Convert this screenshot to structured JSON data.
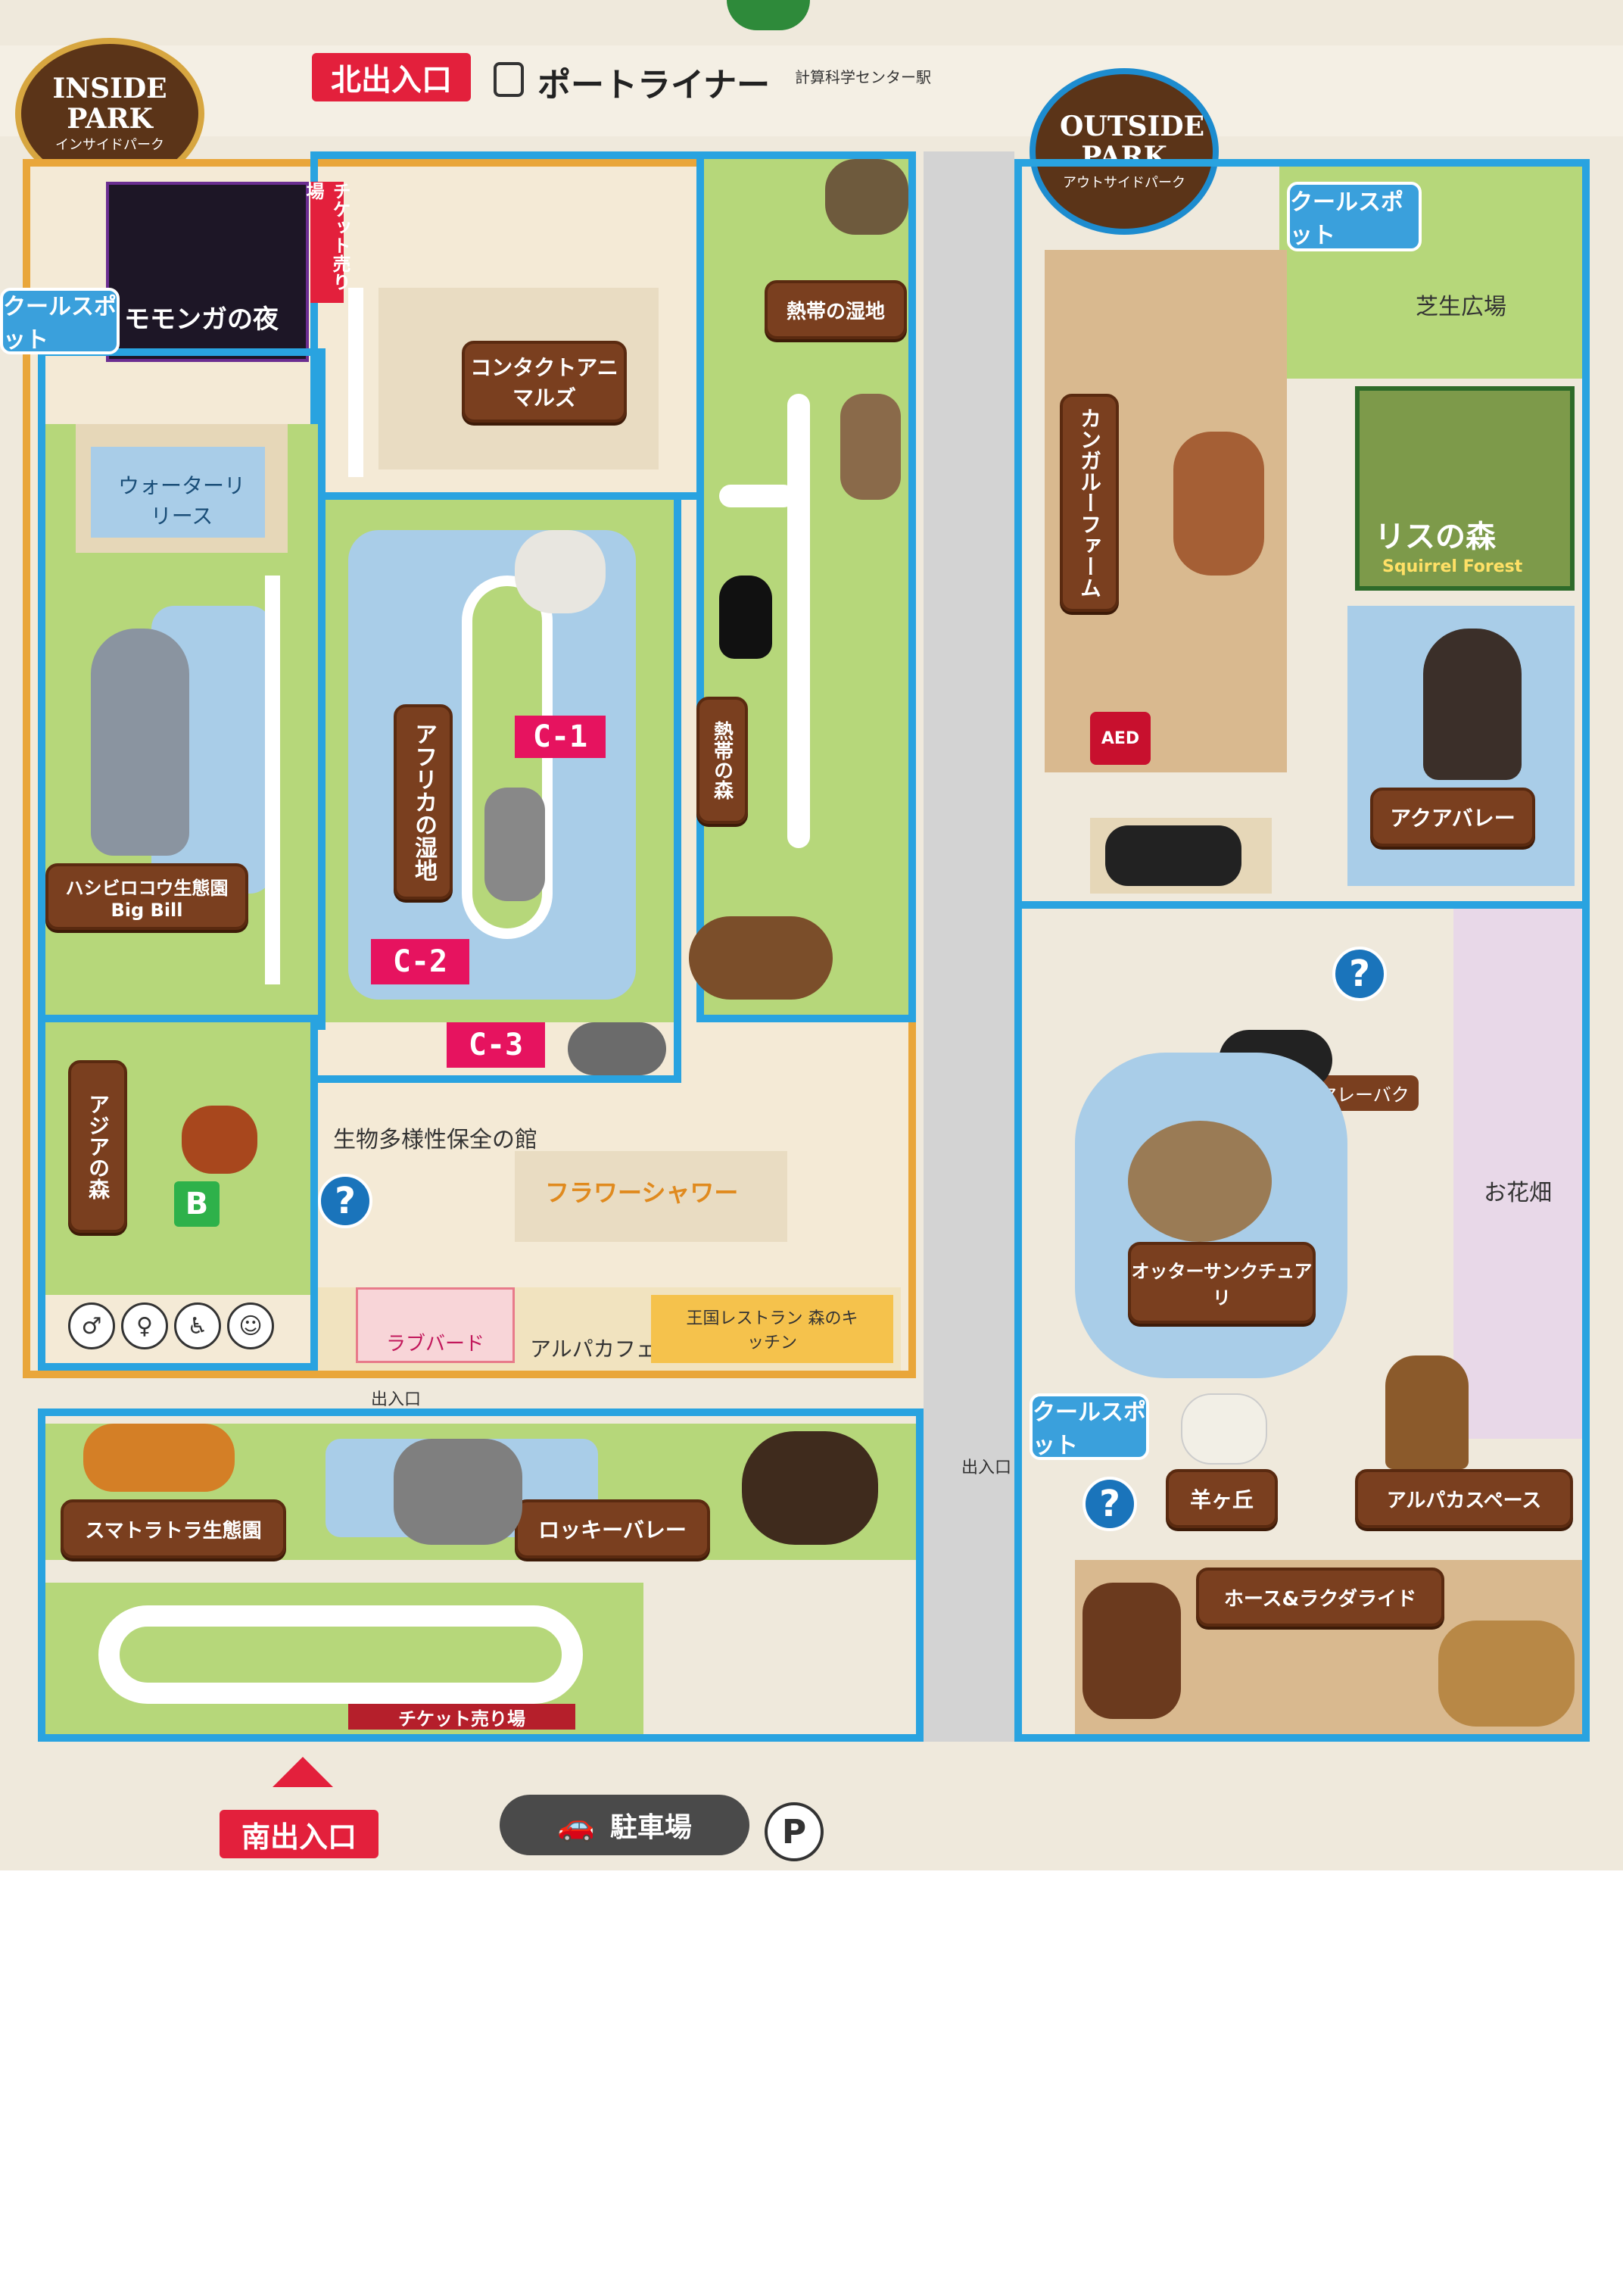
{
  "header": {
    "north_entrance": "北出入口",
    "port_liner": "ポートライナー",
    "port_liner_note": "計算科学センター駅"
  },
  "badges": {
    "inside_park": "INSIDE PARK",
    "inside_park_sub": "インサイドパーク",
    "outside_park": "OUTSIDE PARK",
    "outside_park_sub": "アウトサイドパーク"
  },
  "cool_spot": "クールスポット",
  "areas": {
    "contact_animals": "コンタクトアニマルズ",
    "ticket_office_north": "チケット売り場",
    "hokuhei": "熱帯の湿地",
    "africa": "アフリカの湿地",
    "bird_forest": "熱帯の森",
    "water_release": "ウォーターリリース",
    "big_bill": "ハシビロコウ生態園 Big Bill",
    "asia_forest": "アジアの森",
    "biodiversity": "生物多様性保全の館",
    "flower_shower": "フラワーシャワー",
    "love_bird": "ラブバード",
    "alpaca_cafe": "アルパカフェ",
    "kingdom_restaurant": "王国レストラン 森のキッチン",
    "sumatra_tiger": "スマトラトラ生態園",
    "rocky_valley": "ロッキーバレー",
    "ticket_office_south": "チケット売り場",
    "south_entrance": "南出入口",
    "parking": "駐車場",
    "parking_p": "P",
    "night_event": "モモンガの夜",
    "kangaroo_farm": "カンガルーファーム",
    "squirrel_forest": "リスの森",
    "squirrel_forest_en": "Squirrel Forest",
    "grass_plaza": "芝生広場",
    "aqua_valley": "アクアバレー",
    "malay_tapir": "マレーバク",
    "flower_field": "お花畑",
    "otter": "オッターサンクチュアリ",
    "sheep_hill": "羊ヶ丘",
    "alpaca_space": "アルパカスペース",
    "horse_ride": "ホース&ラクダライド"
  },
  "markers": {
    "c1": "C-1",
    "c2": "C-2",
    "c3": "C-3",
    "b": "B",
    "question": "?",
    "aed": "AED",
    "entrance": "出入口"
  },
  "colors": {
    "zone_border": "#29a3e0",
    "grass": "#b6d77a",
    "water": "#a9cde8",
    "path": "#ffffff",
    "marker_pink": "#e6135f",
    "wood_sign": "#7a3f1f"
  }
}
